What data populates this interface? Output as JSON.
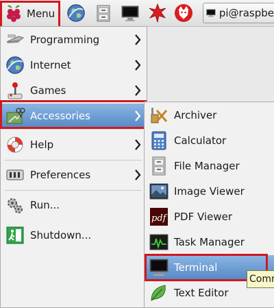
{
  "taskbar": {
    "menu_label": "Menu",
    "launcher_icons": [
      "browser-globe-icon",
      "file-manager-icon",
      "terminal-icon",
      "mathematica-icon",
      "wolfram-icon"
    ],
    "task_button_label": "pi@raspbe"
  },
  "main_menu": {
    "items": [
      {
        "label": "Programming",
        "icon": "programming-icon",
        "has_submenu": true
      },
      {
        "label": "Internet",
        "icon": "internet-globe-icon",
        "has_submenu": true
      },
      {
        "label": "Games",
        "icon": "joystick-icon",
        "has_submenu": true
      },
      {
        "label": "Accessories",
        "icon": "accessories-icon",
        "has_submenu": true,
        "selected": true
      },
      {
        "label": "Help",
        "icon": "lifebuoy-icon",
        "has_submenu": true
      },
      {
        "label": "Preferences",
        "icon": "preferences-icon",
        "has_submenu": true
      },
      {
        "label": "Run...",
        "icon": "run-gears-icon",
        "has_submenu": false
      },
      {
        "label": "Shutdown...",
        "icon": "exit-icon",
        "has_submenu": false
      }
    ]
  },
  "accessories_menu": {
    "items": [
      {
        "label": "Archiver",
        "icon": "archiver-icon"
      },
      {
        "label": "Calculator",
        "icon": "calculator-icon"
      },
      {
        "label": "File Manager",
        "icon": "file-cabinet-icon"
      },
      {
        "label": "Image Viewer",
        "icon": "image-viewer-icon"
      },
      {
        "label": "PDF Viewer",
        "icon": "pdf-icon"
      },
      {
        "label": "Task Manager",
        "icon": "task-manager-icon"
      },
      {
        "label": "Terminal",
        "icon": "terminal-icon",
        "selected": true
      },
      {
        "label": "Text Editor",
        "icon": "text-editor-leaf-icon"
      }
    ]
  },
  "tooltip": {
    "text": "Comm"
  },
  "colors": {
    "highlight_box": "#d0191f",
    "selection": "#5588c4",
    "menu_bg": "#f1f1f1"
  }
}
